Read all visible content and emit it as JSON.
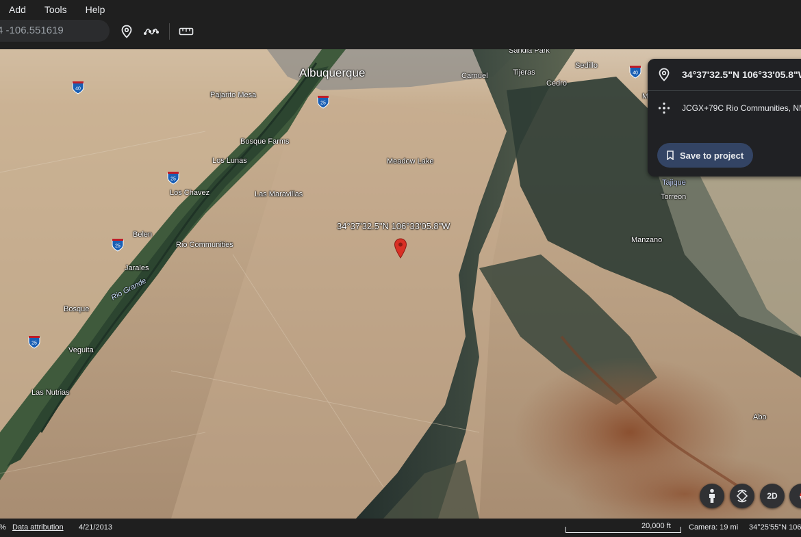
{
  "menu": {
    "items": [
      {
        "label": "Add"
      },
      {
        "label": "Tools"
      },
      {
        "label": "Help"
      }
    ]
  },
  "toolbar": {
    "search_value": "4 -106.551619",
    "icons": [
      "place-pin-icon",
      "path-icon",
      "ruler-icon"
    ]
  },
  "map": {
    "labels": {
      "albuquerque": "Albuquerque",
      "sandia_park": "Sandia Park",
      "sedillo": "Sedillo",
      "carnuel": "Carnuel",
      "tijeras": "Tijeras",
      "cedro": "Cedro",
      "pajarito_mesa": "Pajarito Mesa",
      "bosque_farms": "Bosque Farms",
      "los_lunas": "Los Lunas",
      "meadow_lake": "Meadow Lake",
      "los_chavez": "Los Chavez",
      "las_maravillas": "Las Maravillas",
      "belen": "Belen",
      "rio_communities": "Rio Communities",
      "jarales": "Jarales",
      "rio_grande": "Rio Grande",
      "bosque": "Bosque",
      "veguita": "Veguita",
      "las_nutrias": "Las Nutrias",
      "tajique": "Tajique",
      "torreon": "Torreon",
      "manzano": "Manzano",
      "abo": "Abo",
      "m_partial": "M"
    },
    "shields": {
      "i40_left": "40",
      "i25_top": "25",
      "i25_mid": "25",
      "i25_belen": "25",
      "i25_bottom": "25",
      "i40_right": "40"
    },
    "pin_label": "34°37'32.5\"N 106°33'05.8\"W",
    "pin_color": "#d93025"
  },
  "info_card": {
    "coordinates": "34°37'32.5\"N 106°33'05.8\"W",
    "plus_code": "JCGX+79C Rio Communities, NM",
    "save_label": "Save to project"
  },
  "controls": {
    "pegman_icon": "pegman-icon",
    "rotate_icon": "rotate-view-icon",
    "view_2d_label": "2D",
    "compass_icon": "compass-icon"
  },
  "status": {
    "percent": "%",
    "data_attribution": "Data attribution",
    "imagery_date": "4/21/2013",
    "scale_label": "20,000 ft",
    "camera": "Camera: 19 mi",
    "cursor_coords": "34°25'55\"N 106°"
  },
  "colors": {
    "accent_button": "#334464",
    "panel_bg": "#202124",
    "bar_bg": "#1f1f1f"
  }
}
